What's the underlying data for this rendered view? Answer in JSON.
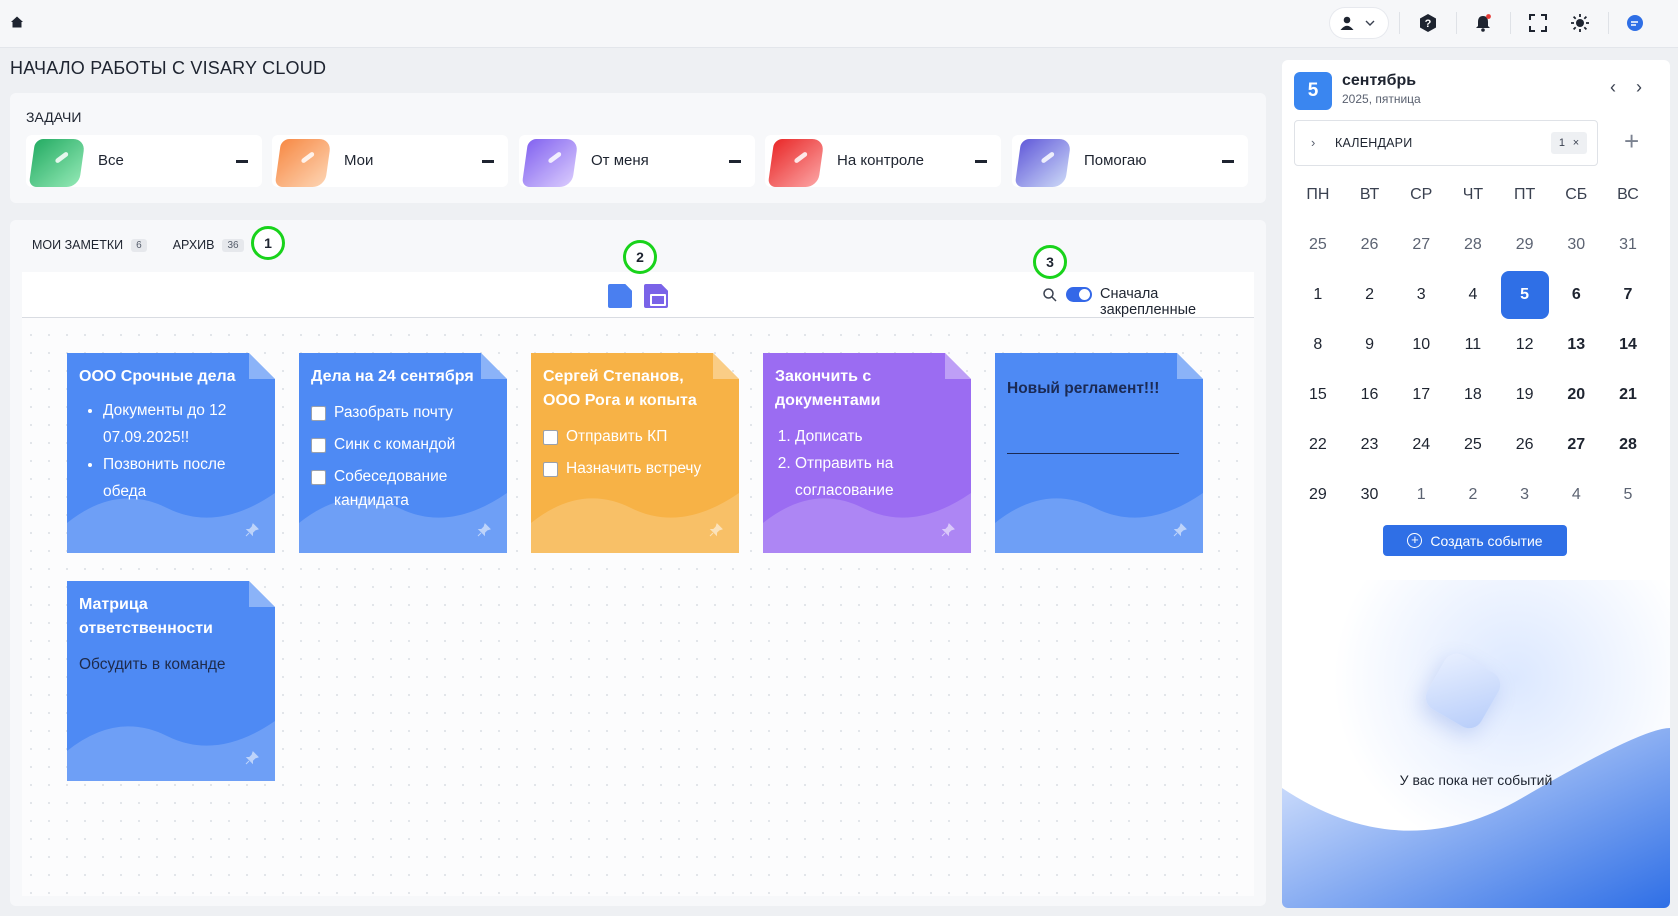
{
  "page_title": "НАЧАЛО РАБОТЫ С VISARY CLOUD",
  "icons": {
    "home": "home-icon",
    "user": "user-icon",
    "help": "help-icon",
    "notifications": "bell-icon",
    "fullscreen": "fullscreen-icon",
    "theme": "sun-icon",
    "chat": "chat-icon"
  },
  "tasks": {
    "title": "ЗАДАЧИ",
    "cards": [
      {
        "label": "Все",
        "color": "#34c57a"
      },
      {
        "label": "Мои",
        "color": "#f8a165"
      },
      {
        "label": "От меня",
        "color": "#9a7cf2"
      },
      {
        "label": "На контроле",
        "color": "#f24a4a"
      },
      {
        "label": "Помогаю",
        "color": "#6a6fe0"
      }
    ]
  },
  "notes_tabs": [
    {
      "label": "МОИ ЗАМЕТКИ",
      "count": "6"
    },
    {
      "label": "АРХИВ",
      "count": "36"
    }
  ],
  "markers": [
    "1",
    "2",
    "3"
  ],
  "toolbar": {
    "pinned_first_label": "Сначала закрепленные",
    "pinned_first_on": true
  },
  "notes": [
    {
      "title": "ООО Срочные дела",
      "color": "#4e8af4",
      "bullets": [
        "Документы до 12 07.09.2025!!",
        "Позвонить после обеда"
      ]
    },
    {
      "title": "Дела на 24 сентября",
      "color": "#4e8af4",
      "checks": [
        "Разобрать почту",
        "Синк с командой",
        "Собеседование кандидата"
      ]
    },
    {
      "title": "Сергей Степанов, ООО Рога и копыта",
      "color": "#f7b246",
      "checks": [
        "Отправить КП",
        "Назначить встречу"
      ]
    },
    {
      "title": "Закончить с документами",
      "color": "#9b6cf2",
      "ordered": [
        "Дописать",
        "Отправить на согласование"
      ]
    },
    {
      "big_text": "Новый регламент!!!",
      "color": "#4e8af4"
    },
    {
      "title": "Матрица ответственности",
      "color": "#4e8af4",
      "text": "Обсудить в команде"
    }
  ],
  "calendar": {
    "day": "5",
    "month": "сентябрь",
    "sub": "2025, пятница",
    "calendars_label": "КАЛЕНДАРИ",
    "calendars_count": "1",
    "weekdays": [
      "ПН",
      "ВТ",
      "СР",
      "ЧТ",
      "ПТ",
      "СБ",
      "ВС"
    ],
    "weeks": [
      [
        "25",
        "26",
        "27",
        "28",
        "29",
        "30",
        "31"
      ],
      [
        "1",
        "2",
        "3",
        "4",
        "5",
        "6",
        "7"
      ],
      [
        "8",
        "9",
        "10",
        "11",
        "12",
        "13",
        "14"
      ],
      [
        "15",
        "16",
        "17",
        "18",
        "19",
        "20",
        "21"
      ],
      [
        "22",
        "23",
        "24",
        "25",
        "26",
        "27",
        "28"
      ],
      [
        "29",
        "30",
        "1",
        "2",
        "3",
        "4",
        "5"
      ]
    ],
    "selected": "5",
    "create_label": "Создать событие",
    "empty_text": "У вас пока нет событий"
  }
}
